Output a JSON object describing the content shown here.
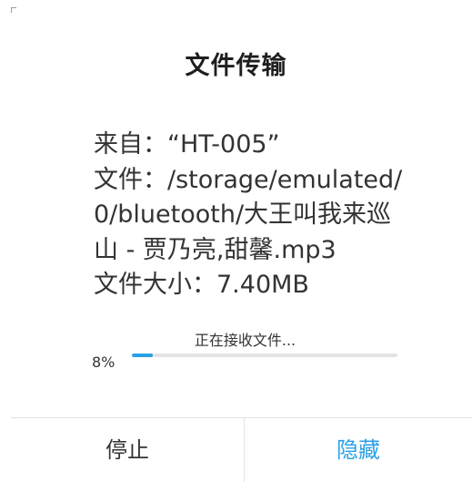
{
  "dialog": {
    "title": "文件传输"
  },
  "info": {
    "line1": "来自：“HT-005”",
    "line2": "文件：/storage/emulated/",
    "line3": "0/bluetooth/大王叫我来巡",
    "line4": "山 - 贾乃亮,甜馨.mp3",
    "line5": "文件大小：7.40MB"
  },
  "progress": {
    "status_text": "正在接收文件...",
    "percent_label": "8%",
    "fraction": 0.08
  },
  "buttons": {
    "stop_label": "停止",
    "hide_label": "隐藏"
  },
  "colors": {
    "accent": "#2aa0e6",
    "track": "#e4e4e4"
  }
}
